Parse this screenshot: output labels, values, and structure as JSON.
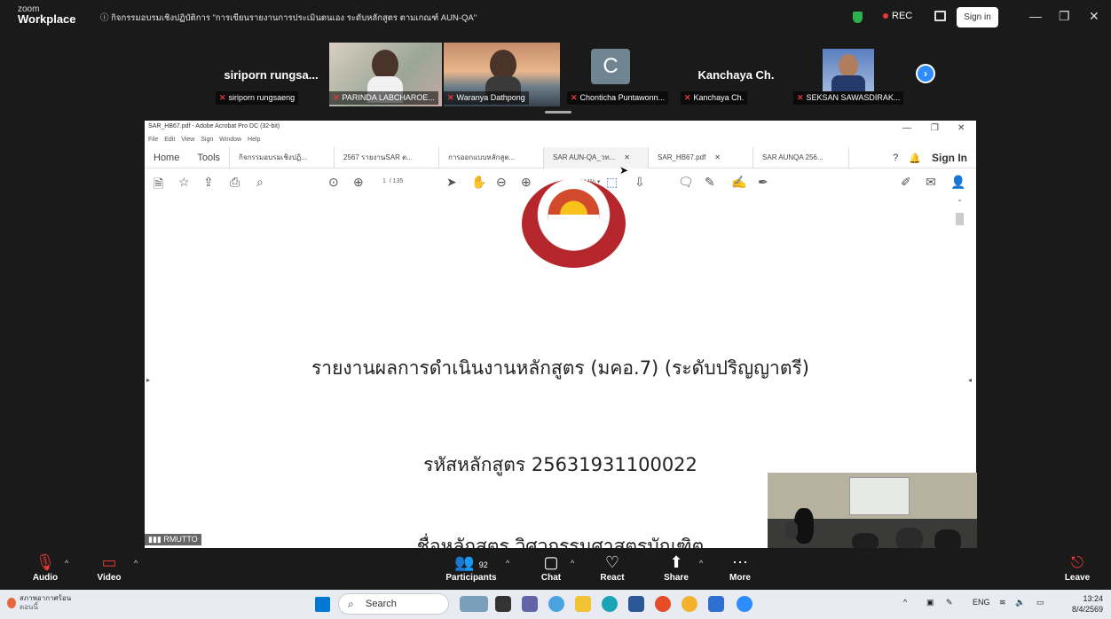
{
  "zoom": {
    "logo_top": "zoom",
    "logo_bottom": "Workplace",
    "meeting_title": "ⓘ กิจกรรมอบรมเชิงปฏิบัติการ \"การเขียนรายงานการประเมินตนเอง ระดับหลักสูตร ตามเกณฑ์ AUN-QA\"",
    "rec_label": "REC",
    "signin_label": "Sign in",
    "min_icon": "minimize-icon",
    "max_icon": "maximize-icon",
    "close_icon": "close-icon"
  },
  "participants": [
    {
      "name": "siriporn rungsa...",
      "label": "siriporn rungsaeng"
    },
    {
      "name": "",
      "label": "PARINDA LABCHAROE..."
    },
    {
      "name": "",
      "label": "Waranya Dathpong"
    },
    {
      "avatar": "C",
      "name": "",
      "label": "Chonticha Puntawonn..."
    },
    {
      "name": "Kanchaya Ch.",
      "label": "Kanchaya Ch."
    },
    {
      "name": "",
      "label": "SEKSAN SAWASDIRAK..."
    }
  ],
  "acrobat": {
    "window_title": "SAR_HB67.pdf - Adobe Acrobat Pro DC (32-bit)",
    "menu": "File  Edit  View  Sign  Window  Help",
    "tabs": {
      "home": "Home",
      "tools": "Tools",
      "docs": [
        "กิจกรรมอบรมเชิงปฏิ...",
        "2567 รายงานSAR ต...",
        "การออกแบบหลักสูต...",
        "SAR AUN-QA_วท...",
        "SAR_HB67.pdf",
        "SAR AUNQA 256..."
      ],
      "sign_in": "Sign In"
    },
    "page_current": "1",
    "page_total": "/ 135",
    "zoom_level": "144%",
    "doc_heading_1": "รายงานผลการดำเนินงานหลักสูตร (มคอ.7) (ระดับปริญญาตรี)",
    "doc_heading_2": "รหัสหลักสูตร 25631931100022",
    "doc_heading_3": "ชื่อหลักสูตร วิศวกรรมศาสตรบัณฑิต"
  },
  "signal_label": "RMUTTO",
  "controls": {
    "audio": "Audio",
    "video": "Video",
    "participants": "Participants",
    "participants_count": "92",
    "chat": "Chat",
    "react": "React",
    "share": "Share",
    "more": "More",
    "leave": "Leave"
  },
  "taskbar": {
    "weather_line1": "สภาพอากาศร้อน",
    "weather_line2": "ตอนนี้",
    "search_placeholder": "Search",
    "lang": "ENG",
    "time": "13:24",
    "date": "8/4/2569"
  }
}
